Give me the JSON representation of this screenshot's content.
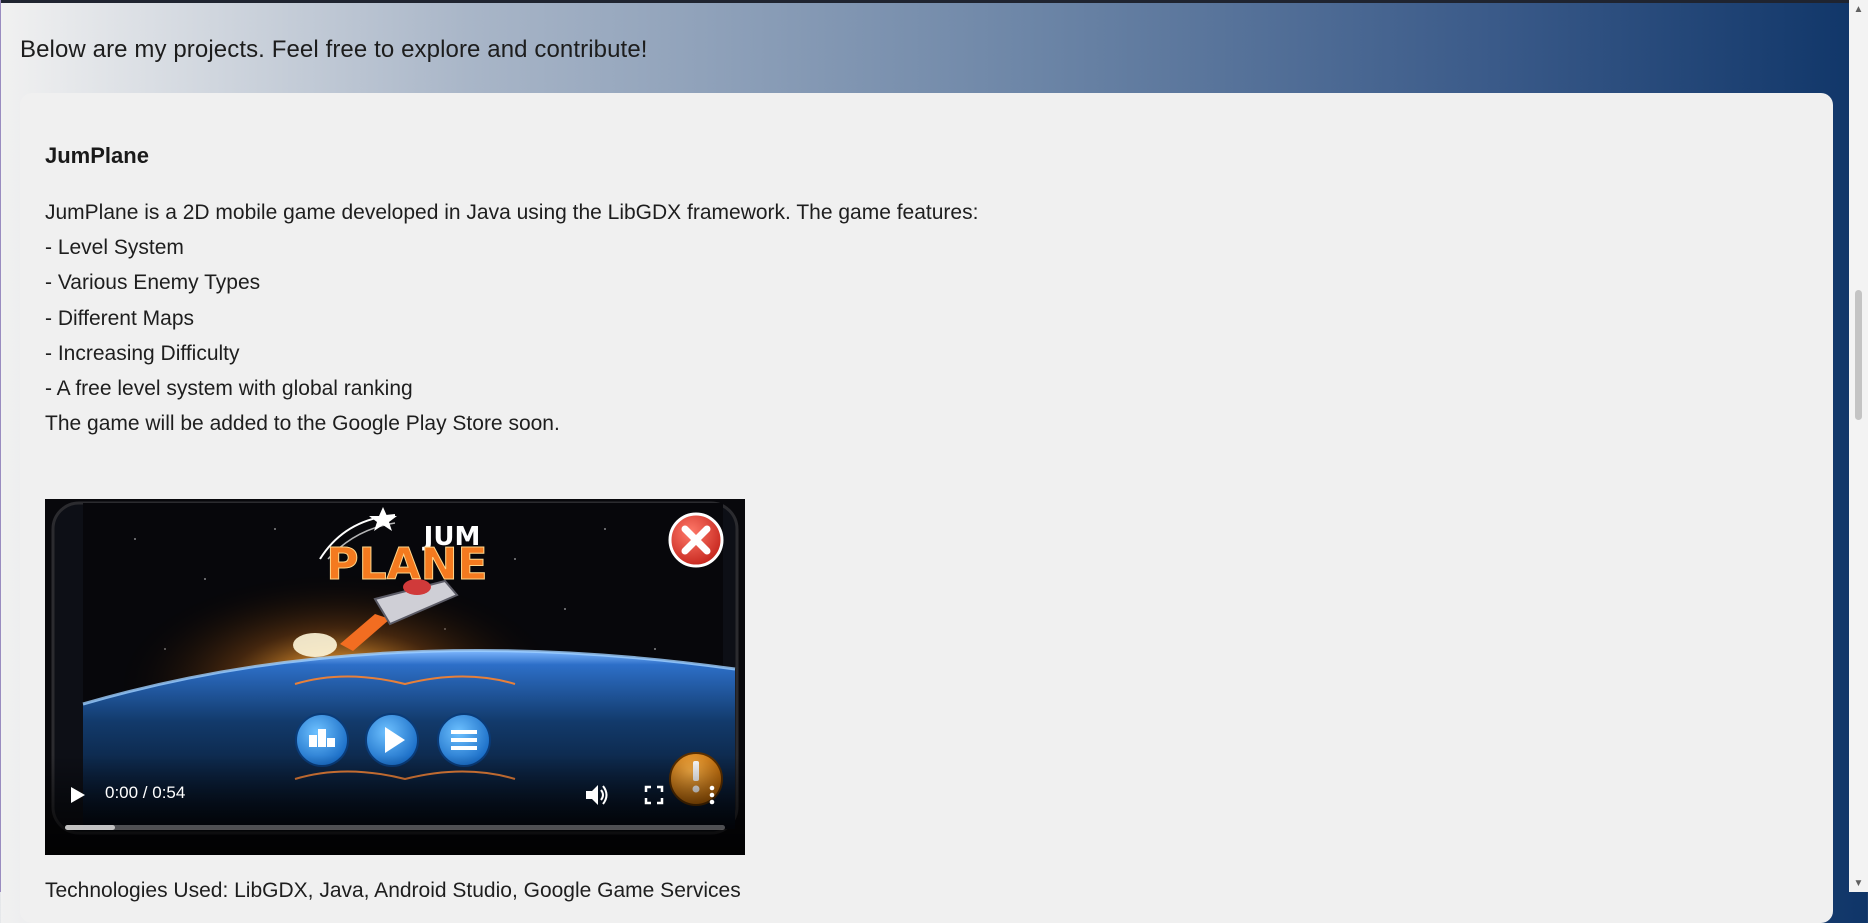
{
  "page": {
    "intro_text": "Below are my projects. Feel free to explore and contribute!"
  },
  "project": {
    "title": "JumPlane",
    "description_lines": [
      "JumPlane is a 2D mobile game developed in Java using the LibGDX framework. The game features:",
      "- Level System",
      "- Various Enemy Types",
      "- Different Maps",
      "- Increasing Difficulty",
      "- A free level system with global ranking",
      "The game will be added to the Google Play Store soon."
    ],
    "video": {
      "time_display": "0:00 / 0:54",
      "progress_fraction": 0.0,
      "game_logo_top": "JUM",
      "game_logo_bottom": "PLANE"
    },
    "next_line": "Technologies Used: LibGDX, Java, Android Studio, Google Game Services"
  },
  "colors": {
    "card_background": "#f0f0f0",
    "gradient_end": "#0f3568",
    "logo_orange": "#f47a1f"
  },
  "icons": [
    "play-icon",
    "volume-icon",
    "fullscreen-icon",
    "more-vert-icon",
    "scroll-up-arrow",
    "scroll-down-arrow"
  ]
}
